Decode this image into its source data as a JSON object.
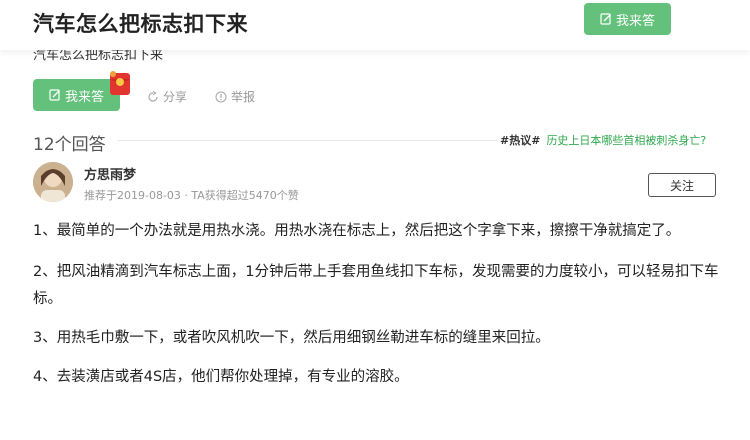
{
  "header": {
    "title": "汽车怎么把标志扣下来",
    "answer_button": "我来答"
  },
  "question": {
    "subtitle": "汽车怎么把标志扣下来",
    "answer_button": "我来答",
    "share": "分享",
    "report": "举报"
  },
  "answers": {
    "count_label": "12个回答",
    "hot_tag": "#热议#",
    "hot_link": "历史上日本哪些首相被刺杀身亡?"
  },
  "author": {
    "name": "方思雨梦",
    "meta": "推荐于2019-08-03 · TA获得超过5470个赞",
    "follow_label": "关注"
  },
  "answer_body": {
    "p1": "1、最简单的一个办法就是用热水浇。用热水浇在标志上，然后把这个字拿下来，擦擦干净就搞定了。",
    "p2": "2、把风油精滴到汽车标志上面，1分钟后带上手套用鱼线扣下车标，发现需要的力度较小，可以轻易扣下车标。",
    "p3": "3、用热毛巾敷一下，或者吹风机吹一下，然后用细钢丝勒进车标的缝里来回拉。",
    "p4": "4、去装潢店或者4S店，他们帮你处理掉，有专业的溶胶。"
  },
  "colors": {
    "accent_green": "#64c17b",
    "link_green": "#2fa84f"
  }
}
